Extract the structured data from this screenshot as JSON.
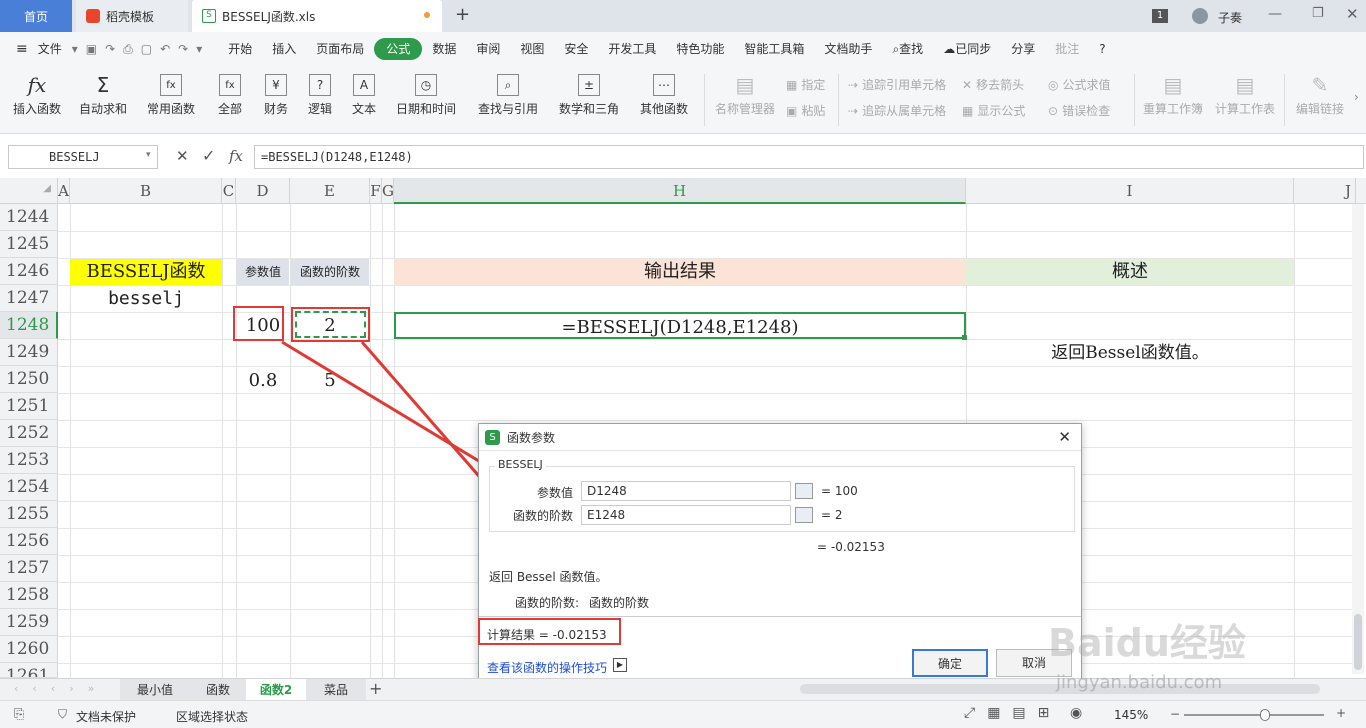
{
  "tabs": {
    "home": "首页",
    "template": "稻壳模板",
    "file": "BESSELJ函数.xls",
    "new": "+"
  },
  "window": {
    "badge": "1",
    "user": "子奏"
  },
  "menu": {
    "file": "文件",
    "items": [
      "开始",
      "插入",
      "页面布局",
      "公式",
      "数据",
      "审阅",
      "视图",
      "安全",
      "开发工具",
      "特色功能",
      "智能工具箱",
      "文档助手"
    ],
    "search": "查找",
    "sync": "已同步",
    "share": "分享",
    "comment": "批注",
    "help": "?"
  },
  "ribbon": {
    "buttons": [
      {
        "label": "插入函数",
        "icon": "fx"
      },
      {
        "label": "自动求和",
        "icon": "Σ"
      },
      {
        "label": "常用函数",
        "icon": "fx"
      },
      {
        "label": "全部",
        "icon": "fx"
      },
      {
        "label": "财务",
        "icon": "¥"
      },
      {
        "label": "逻辑",
        "icon": "?"
      },
      {
        "label": "文本",
        "icon": "A"
      },
      {
        "label": "日期和时间",
        "icon": "◷"
      },
      {
        "label": "查找与引用",
        "icon": "⌕"
      },
      {
        "label": "数学和三角",
        "icon": "±"
      },
      {
        "label": "其他函数",
        "icon": "⋯"
      }
    ],
    "disabled": {
      "name_mgr": "名称管理器",
      "define": "指定",
      "paste": "粘贴",
      "trace_prec": "追踪引用单元格",
      "trace_dep": "追踪从属单元格",
      "remove": "移去箭头",
      "show": "显示公式",
      "eval": "公式求值",
      "check": "错误检查",
      "recalc": "重算工作簿",
      "calc_sheet": "计算工作表",
      "edit_links": "编辑链接"
    }
  },
  "formula_bar": {
    "name": "BESSELJ",
    "formula": "=BESSELJ(D1248,E1248)",
    "fx": "fx"
  },
  "columns": [
    "A",
    "B",
    "C",
    "D",
    "E",
    "F",
    "G",
    "H",
    "I",
    "J"
  ],
  "rows": [
    "1244",
    "1245",
    "1246",
    "1247",
    "1248",
    "1249",
    "1250",
    "1251",
    "1252",
    "1253",
    "1254",
    "1255",
    "1256",
    "1257",
    "1258",
    "1259",
    "1260",
    "1261"
  ],
  "cells": {
    "title": "BESSELJ函数",
    "name": "besselj",
    "hdr_param": "参数值",
    "hdr_order": "函数的阶数",
    "hdr_output": "输出结果",
    "hdr_desc": "概述",
    "d1248": "100",
    "e1248": "2",
    "h1248": "=BESSELJ(D1248,E1248)",
    "i1249": "返回Bessel函数值。",
    "d1250": "0.8",
    "e1250": "5"
  },
  "sheets": [
    "最小值",
    "函数",
    "函数2",
    "菜品"
  ],
  "status": {
    "protect": "文档未保护",
    "select": "区域选择状态",
    "zoom": "145%"
  },
  "dialog": {
    "title": "函数参数",
    "group": "BESSELJ",
    "arg1_label": "参数值",
    "arg1_value": "D1248",
    "arg1_result": "= 100",
    "arg2_label": "函数的阶数",
    "arg2_value": "E1248",
    "arg2_result": "= 2",
    "result": "= -0.02153",
    "desc": "返回 Bessel 函数值。",
    "arg_desc_label": "函数的阶数:",
    "arg_desc_text": "函数的阶数",
    "calc_result": "计算结果 = -0.02153",
    "link": "查看该函数的操作技巧",
    "ok": "确定",
    "cancel": "取消"
  },
  "watermark": {
    "text": "Baidu经验",
    "url": "jingyan.baidu.com"
  },
  "colors": {
    "accent": "#2e9a4b",
    "yellow": "#ffff00",
    "salmon": "#fbe3d6",
    "green_light": "#e2efda",
    "red": "#e03a35"
  }
}
